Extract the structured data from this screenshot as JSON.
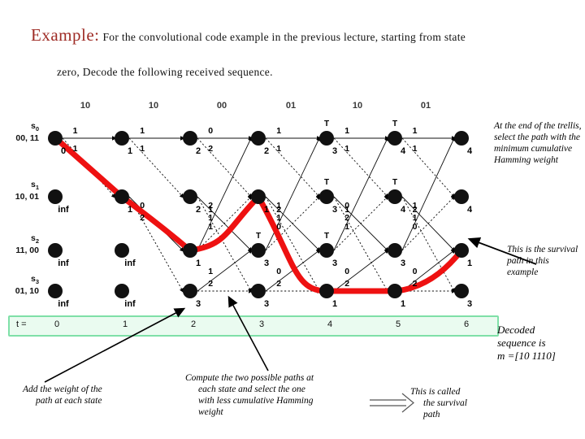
{
  "slide": {
    "title_keyword": "Example:",
    "title_text": "For the convolutional code example in the previous lecture, starting from state",
    "title_text_line2": "zero, Decode the following received sequence."
  },
  "trellis": {
    "received_sequence": [
      "10",
      "10",
      "00",
      "01",
      "10",
      "01"
    ],
    "state_labels": [
      {
        "name": "s",
        "sub": "0",
        "outputs": "00, 11"
      },
      {
        "name": "s",
        "sub": "1",
        "outputs": "10, 01"
      },
      {
        "name": "s",
        "sub": "2",
        "outputs": "11, 00"
      },
      {
        "name": "s",
        "sub": "3",
        "outputs": "01, 10"
      }
    ],
    "time_axis": {
      "label": "t =",
      "ticks": [
        "0",
        "1",
        "2",
        "3",
        "4",
        "5",
        "6"
      ]
    },
    "state_metrics": [
      [
        "0",
        "inf",
        "inf",
        "inf"
      ],
      [
        "1",
        "1",
        "inf",
        "inf"
      ],
      [
        "2",
        "2",
        "1",
        "3"
      ],
      [
        "2",
        "1",
        "3",
        "3"
      ],
      [
        "3",
        "3",
        "3",
        "1"
      ],
      [
        "4",
        "4",
        "3",
        "1"
      ],
      [
        "4",
        "4",
        "1",
        "3"
      ]
    ],
    "tie_marker": "T",
    "tie_positions": [
      {
        "col": 4,
        "row": 0
      },
      {
        "col": 4,
        "row": 1
      },
      {
        "col": 4,
        "row": 2
      },
      {
        "col": 3,
        "row": 2
      },
      {
        "col": 5,
        "row": 0
      },
      {
        "col": 5,
        "row": 1
      }
    ],
    "branch_weights": {
      "t0": [
        "1",
        "1"
      ],
      "t1": [
        "1",
        "1",
        "0",
        "2"
      ],
      "t2": [
        "0",
        "2",
        "2",
        "1",
        "1",
        "1",
        "1",
        "2"
      ],
      "t3": [
        "1",
        "1",
        "1",
        "1",
        "2",
        "0",
        "0",
        "2"
      ],
      "t4": [
        "1",
        "1",
        "0",
        "2",
        "1",
        "1",
        "0",
        "2"
      ],
      "t5": [
        "1",
        "1",
        "1",
        "1",
        "2",
        "0",
        "0",
        "2"
      ]
    }
  },
  "notes": {
    "end_of_trellis": "At the end of the trellis, select the path with the minimum cumulative Hamming weight",
    "survival_path": "This is the survival path in this example",
    "decoded_line1": "Decoded",
    "decoded_line2": "sequence is",
    "decoded_line3": "m =[10 1110]",
    "add_weight_l1": "Add the weight of the",
    "add_weight_l2": "path at each state",
    "compute_l1": "Compute the two possible paths at",
    "compute_l2": "each state and select the one",
    "compute_l3": "with less cumulative Hamming",
    "compute_l4": "weight",
    "called_l1": "This is called",
    "called_l2": "the survival",
    "called_l3": "path"
  },
  "colors": {
    "title_accent": "#9e2b25",
    "survival_path": "#ee1111",
    "taxis_border": "#7fe0a8",
    "taxis_fill": "#eafbf0",
    "node": "#111111"
  }
}
